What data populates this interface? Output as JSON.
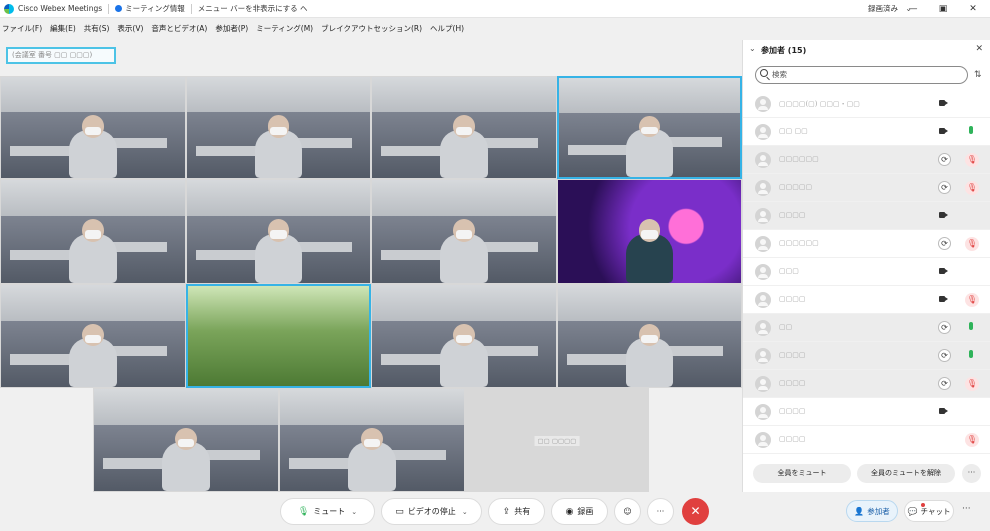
{
  "titlebar": {
    "app_name": "Cisco Webex Meetings",
    "meeting_info": "ミーティング情報",
    "menu_hint": "メニュー バーを非表示にする ヘ",
    "status": "録画済み",
    "minimize": "—",
    "maximize": "▣",
    "close": "✕"
  },
  "menu": [
    "ファイル(F)",
    "編集(E)",
    "共有(S)",
    "表示(V)",
    "音声とビデオ(A)",
    "参加者(P)",
    "ミーティング(M)",
    "ブレイクアウトセッション(R)",
    "ヘルプ(H)"
  ],
  "meeting_chip": "(会議室 番号 ▢▢ ▢▢▢)",
  "video_tiles": [
    {
      "kind": "office",
      "name": ""
    },
    {
      "kind": "office",
      "name": ""
    },
    {
      "kind": "office",
      "name": ""
    },
    {
      "kind": "office",
      "name": "",
      "active": true
    },
    {
      "kind": "office",
      "name": ""
    },
    {
      "kind": "office",
      "name": ""
    },
    {
      "kind": "office",
      "name": ""
    },
    {
      "kind": "space",
      "name": ""
    },
    {
      "kind": "office",
      "name": ""
    },
    {
      "kind": "forest",
      "name": "",
      "active": true
    },
    {
      "kind": "office",
      "name": ""
    },
    {
      "kind": "office",
      "name": ""
    },
    {
      "kind": "office",
      "name": ""
    },
    {
      "kind": "office",
      "name": ""
    },
    {
      "kind": "empty",
      "name": "▢▢ ▢▢▢▢"
    }
  ],
  "controls": {
    "mute": "ミュート",
    "stop_video": "ビデオの停止",
    "share": "共有",
    "record": "録画",
    "reactions": "☺",
    "more": "···",
    "end": "✕"
  },
  "panel": {
    "title": "参加者 (15)",
    "search_placeholder": "検索",
    "participants": [
      {
        "name": "▢▢▢▢(▢)  ▢▢▢・▢▢",
        "shade": false,
        "status": "cam",
        "mic": "none"
      },
      {
        "name": "▢▢ ▢▢",
        "shade": false,
        "status": "cam",
        "mic": "on"
      },
      {
        "name": "▢▢▢▢▢▢",
        "shade": true,
        "status": "sync",
        "mic": "off"
      },
      {
        "name": "▢▢▢▢▢",
        "shade": true,
        "status": "sync",
        "mic": "off"
      },
      {
        "name": "▢▢▢▢",
        "shade": true,
        "status": "cam",
        "mic": "none"
      },
      {
        "name": "▢▢▢▢▢▢",
        "shade": false,
        "status": "sync",
        "mic": "off"
      },
      {
        "name": "▢▢▢",
        "shade": false,
        "status": "cam",
        "mic": "none"
      },
      {
        "name": "▢▢▢▢",
        "shade": false,
        "status": "cam",
        "mic": "off"
      },
      {
        "name": "▢▢",
        "shade": true,
        "status": "sync",
        "mic": "on"
      },
      {
        "name": "▢▢▢▢",
        "shade": true,
        "status": "sync",
        "mic": "on"
      },
      {
        "name": "▢▢▢▢",
        "shade": true,
        "status": "sync",
        "mic": "off"
      },
      {
        "name": "▢▢▢▢",
        "shade": false,
        "status": "cam",
        "mic": "none"
      },
      {
        "name": "▢▢▢▢",
        "shade": false,
        "status": "none",
        "mic": "off"
      }
    ],
    "mute_all": "全員をミュート",
    "unmute_all": "全員のミュートを解除",
    "more": "···"
  },
  "bottom_tabs": {
    "participants": "参加者",
    "chat": "チャット",
    "more": "···"
  },
  "colors": {
    "accent": "#36b3e6",
    "end_call": "#e0403f",
    "mic_on": "#2fb35a"
  }
}
